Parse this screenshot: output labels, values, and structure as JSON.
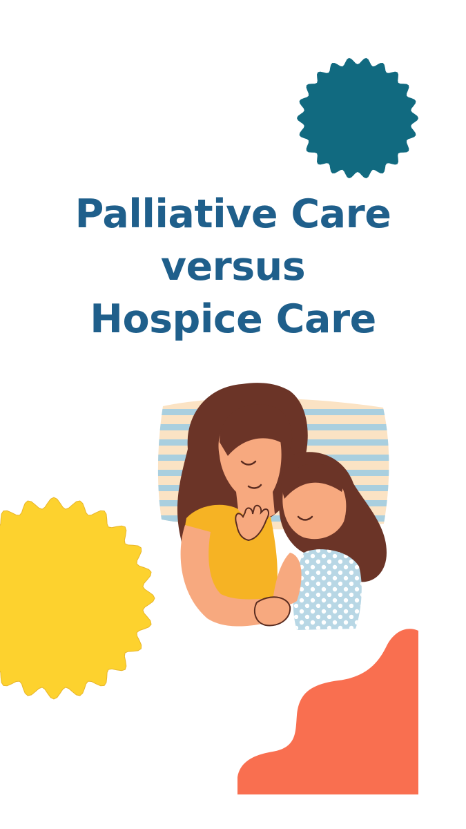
{
  "title": {
    "line1": "Palliative Care",
    "line2": "versus",
    "line3": "Hospice Care"
  },
  "colors": {
    "title": "#1f5f8b",
    "teal_badge": "#116a80",
    "yellow_sun": "#fdd22e",
    "coral_blob": "#f96f50",
    "hair": "#6b3427",
    "skin": "#f7a97f",
    "mother_shirt": "#f6b324",
    "child_dress": "#b8d7e5",
    "pillow_stripe": "#a9cfdf",
    "pillow_base": "#fbe3c4",
    "outline": "#5a2c20"
  },
  "illustration": {
    "subject": "mother hugging sleeping daughter on striped pillow"
  }
}
